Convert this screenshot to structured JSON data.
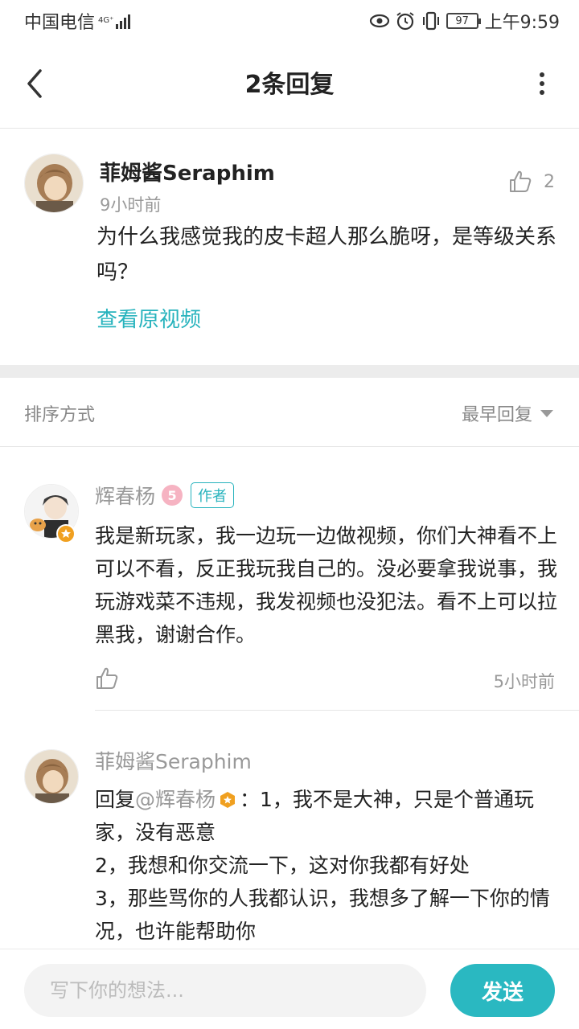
{
  "status_bar": {
    "carrier": "中国电信",
    "network": "4G⁺",
    "battery": "97",
    "time": "上午9:59"
  },
  "header": {
    "title": "2条回复"
  },
  "original_comment": {
    "author": "菲姆酱Seraphim",
    "time": "9小时前",
    "likes": "2",
    "text": "为什么我感觉我的皮卡超人那么脆呀，是等级关系吗？",
    "view_video_link": "查看原视频"
  },
  "sort": {
    "label": "排序方式",
    "selected": "最早回复"
  },
  "replies": [
    {
      "author": "辉春杨",
      "level": "5",
      "tag": "作者",
      "text": "我是新玩家，我一边玩一边做视频，你们大神看不上可以不看，反正我玩我自己的。没必要拿我说事，我玩游戏菜不违规，我发视频也没犯法。看不上可以拉黑我，谢谢合作。",
      "time": "5小时前"
    },
    {
      "author": "菲姆酱Seraphim",
      "reply_prefix": "回复",
      "mention": "@辉春杨",
      "text_after_mention": "：1，我不是大神，只是个普通玩家，没有恶意",
      "line2": "2，我想和你交流一下，这对你我都有好处",
      "line3": "3，那些骂你的人我都认识，我想多了解一下你的情况，也许能帮助你"
    }
  ],
  "bottom_bar": {
    "placeholder": "写下你的想法...",
    "send_label": "发送"
  },
  "colors": {
    "accent": "#2ab8c1",
    "link": "#27b3bd",
    "badge_gold": "#f0a020"
  }
}
